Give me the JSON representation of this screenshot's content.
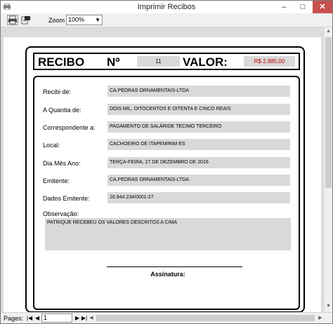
{
  "window": {
    "title": "Imprimir Recibos",
    "min_symbol": "–",
    "max_symbol": "□",
    "close_symbol": "✕"
  },
  "toolbar": {
    "zoom_label": "Zoom",
    "zoom_value": "100%"
  },
  "receipt": {
    "title": "RECIBO",
    "number_label": "Nº",
    "number": "11",
    "value_label": "VALOR:",
    "value": "R$ 2.885,00",
    "fields": [
      {
        "label": "Recibi de:",
        "value": "CA.PEDRAS ORNAMENTAIS-LTDA"
      },
      {
        "label": "A Quantia de:",
        "value": "DOIS MIL, OITOCENTOS E OITENTA E CINCO REAIS"
      },
      {
        "label": "Correspondente  a:",
        "value": "PAGAMENTO DE SALÁRIDE TECIMO TERCEIRO"
      },
      {
        "label": "Local:",
        "value": "CACHOEIRO DE ITAPEMIRIM ES"
      },
      {
        "label": "Dia Mês Ano:",
        "value": "TERÇA-FEIRA, 27 DE DEZEMBRO DE 2016"
      },
      {
        "label": "Emitente:",
        "value": "CA.PEDRAS ORNAMENTAIS-LTDA"
      },
      {
        "label": "Dados Emitente:",
        "value": "16.944.234/0001-27"
      }
    ],
    "observation_label": "Observação:",
    "observation": "PATRIQUE RECEBEU OS VALORES DESCRITOS A CIMA",
    "signature_label": "Assinatura:"
  },
  "statusbar": {
    "pages_label": "Pages:",
    "page_value": "1"
  },
  "icons": {
    "app": "printer-icon",
    "print": "print-icon",
    "export": "export-icon"
  }
}
